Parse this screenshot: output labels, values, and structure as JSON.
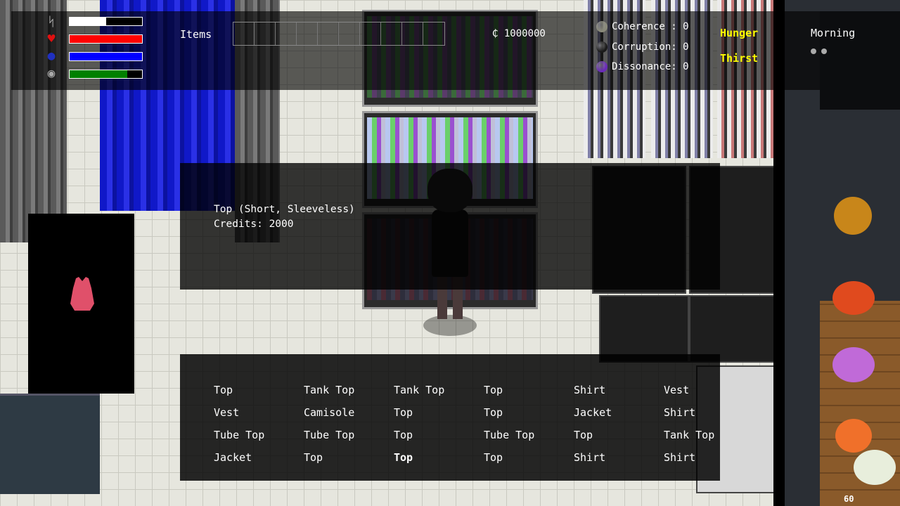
{
  "hud": {
    "stats": [
      {
        "icon": "energy-icon",
        "color": "#ffffff",
        "fill": 0.5
      },
      {
        "icon": "heart-icon",
        "color": "#ff0000",
        "fill": 1.0
      },
      {
        "icon": "blue-grapes-icon",
        "color": "#0000ff",
        "fill": 1.0
      },
      {
        "icon": "mixed-orb-icon",
        "color": "#008000",
        "fill": 0.8
      }
    ],
    "items_label": "Items",
    "item_slot_count": 10,
    "currency": "₵ 1000000",
    "metrics": [
      {
        "label": "Coherence : 0",
        "orb_color": "#8a8a7a",
        "icon": "coherence-orb-icon"
      },
      {
        "label": "Corruption: 0",
        "orb_color": "#1a1a1a",
        "icon": "corruption-orb-icon"
      },
      {
        "label": "Dissonance: 0",
        "orb_color": "#6a2ab8",
        "icon": "dissonance-orb-icon"
      }
    ],
    "needs": [
      {
        "label": "Hunger",
        "color": "#ffff00"
      },
      {
        "label": "Thirst",
        "color": "#ffff00"
      }
    ],
    "time_of_day": "Morning"
  },
  "info": {
    "line1": "Top (Short, Sleeveless)",
    "line2": "Credits: 2000",
    "preview_icon": "top-garment-icon",
    "preview_color": "#e0506a"
  },
  "menu": {
    "items": [
      [
        "Top",
        "Tank Top",
        "Tank Top",
        "Top",
        "Shirt",
        "Vest"
      ],
      [
        "Vest",
        "Camisole",
        "Top",
        "Top",
        "Jacket",
        "Shirt"
      ],
      [
        "Tube Top",
        "Tube Top",
        "Top",
        "Tube Top",
        "Top",
        "Tank Top"
      ],
      [
        "Jacket",
        "Top",
        "Top",
        "Top",
        "Shirt",
        "Shirt"
      ]
    ],
    "selected": [
      3,
      2
    ]
  },
  "fps": "60"
}
